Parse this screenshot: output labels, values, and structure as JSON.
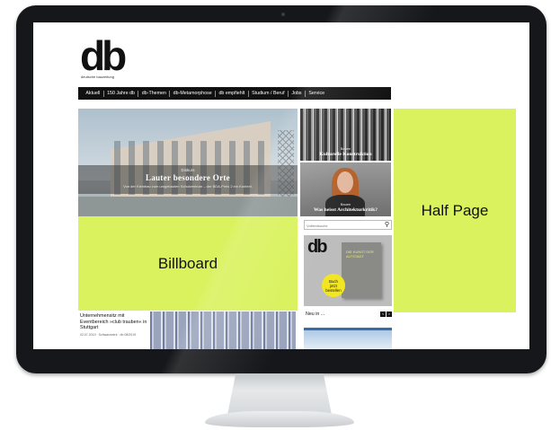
{
  "site": {
    "logo": "db",
    "logo_subtitle": "deutsche bauzeitung"
  },
  "nav": {
    "items": [
      "Aktuell",
      "150 Jahre db",
      "db-Themen",
      "db-Metamorphose",
      "db empfiehlt",
      "Studium / Beruf",
      "Jobs",
      "Service"
    ]
  },
  "hero": {
    "kicker": "Diskurs",
    "title": "Lauter besondere Orte",
    "teaser": "Von der Kleinbau zum umgebauten Schulzentrum – der BDA-Preis 2 ein Kontext."
  },
  "teasers": [
    {
      "kicker": "Bauen",
      "title": "Kulturelle Konstruktion"
    },
    {
      "kicker": "Bauen",
      "title": "Was heisst Architekturkritik?"
    }
  ],
  "ads": {
    "billboard": "Billboard",
    "half_page": "Half Page"
  },
  "search": {
    "placeholder": "Volltextsuche"
  },
  "promo": {
    "logo": "db",
    "book_text": "DIE KUNST DER ALTSTADT",
    "badge_line1": "Buch",
    "badge_line2": "jetzt",
    "badge_line3": "bestellen"
  },
  "new_section": {
    "label": "Neu in ...",
    "prev": "<",
    "next": ">"
  },
  "article": {
    "title": "Unternehmensitz mit Eventbereich »club trauben« in Stuttgart",
    "meta": "02.07.2019 · Schwarzwerk · db 08/2019"
  }
}
